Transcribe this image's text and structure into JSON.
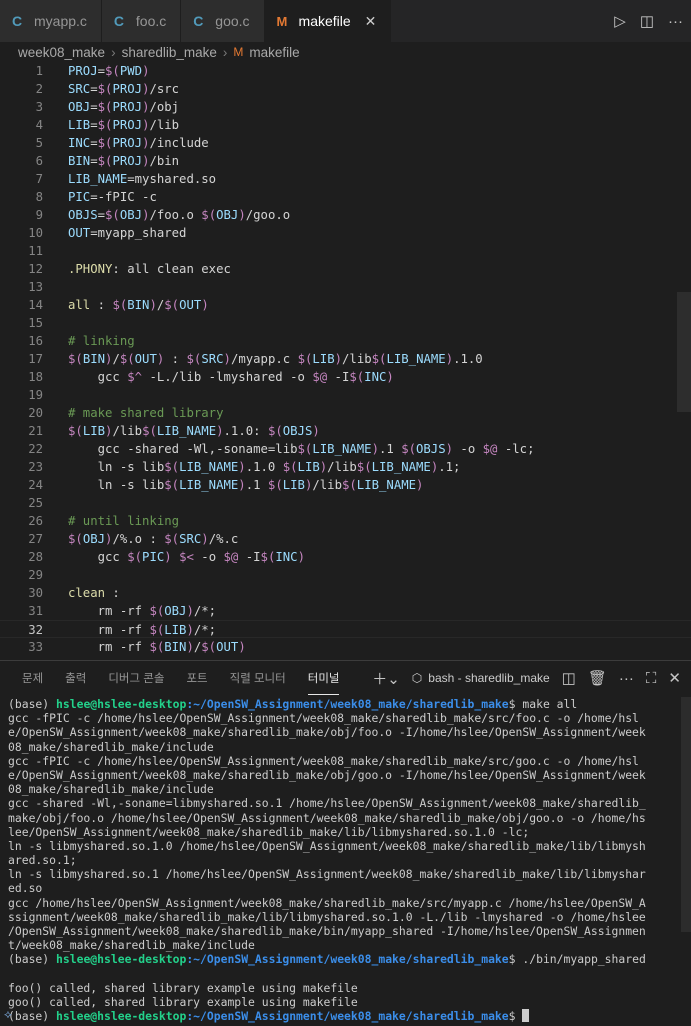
{
  "tabs": [
    {
      "label": "myapp.c",
      "icon": "c-file-icon",
      "active": false
    },
    {
      "label": "foo.c",
      "icon": "c-file-icon",
      "active": false
    },
    {
      "label": "goo.c",
      "icon": "c-file-icon",
      "active": false
    },
    {
      "label": "makefile",
      "icon": "makefile-icon",
      "active": true
    }
  ],
  "breadcrumb": [
    "week08_make",
    "sharedlib_make",
    "makefile"
  ],
  "editor": {
    "current_line": 32,
    "lines": [
      {
        "n": "1",
        "html": "<span class='v'>PROJ</span>=<span class='d'>$(</span><span class='v'>PWD</span><span class='d'>)</span>"
      },
      {
        "n": "2",
        "html": "<span class='v'>SRC</span>=<span class='d'>$(</span><span class='v'>PROJ</span><span class='d'>)</span>/src"
      },
      {
        "n": "3",
        "html": "<span class='v'>OBJ</span>=<span class='d'>$(</span><span class='v'>PROJ</span><span class='d'>)</span>/obj"
      },
      {
        "n": "4",
        "html": "<span class='v'>LIB</span>=<span class='d'>$(</span><span class='v'>PROJ</span><span class='d'>)</span>/lib"
      },
      {
        "n": "5",
        "html": "<span class='v'>INC</span>=<span class='d'>$(</span><span class='v'>PROJ</span><span class='d'>)</span>/include"
      },
      {
        "n": "6",
        "html": "<span class='v'>BIN</span>=<span class='d'>$(</span><span class='v'>PROJ</span><span class='d'>)</span>/bin"
      },
      {
        "n": "7",
        "html": "<span class='v'>LIB_NAME</span>=myshared.so"
      },
      {
        "n": "8",
        "html": "<span class='v'>PIC</span>=-fPIC -c"
      },
      {
        "n": "9",
        "html": "<span class='v'>OBJS</span>=<span class='d'>$(</span><span class='v'>OBJ</span><span class='d'>)</span>/foo.o <span class='d'>$(</span><span class='v'>OBJ</span><span class='d'>)</span>/goo.o"
      },
      {
        "n": "10",
        "html": "<span class='v'>OUT</span>=myapp_shared"
      },
      {
        "n": "11",
        "html": ""
      },
      {
        "n": "12",
        "html": "<span class='kw'>.PHONY</span>: all clean exec"
      },
      {
        "n": "13",
        "html": ""
      },
      {
        "n": "14",
        "html": "<span class='kw'>all</span> : <span class='d'>$(</span><span class='v'>BIN</span><span class='d'>)</span>/<span class='d'>$(</span><span class='v'>OUT</span><span class='d'>)</span>"
      },
      {
        "n": "15",
        "html": ""
      },
      {
        "n": "16",
        "html": "<span class='cm'># linking</span>"
      },
      {
        "n": "17",
        "html": "<span class='d'>$(</span><span class='v'>BIN</span><span class='d'>)</span>/<span class='d'>$(</span><span class='v'>OUT</span><span class='d'>)</span> : <span class='d'>$(</span><span class='v'>SRC</span><span class='d'>)</span>/myapp.c <span class='d'>$(</span><span class='v'>LIB</span><span class='d'>)</span>/lib<span class='d'>$(</span><span class='v'>LIB_NAME</span><span class='d'>)</span>.1.0"
      },
      {
        "n": "18",
        "html": "    gcc <span class='d'>$^</span> -L./lib -lmyshared -o <span class='d'>$@</span> -I<span class='d'>$(</span><span class='v'>INC</span><span class='d'>)</span>"
      },
      {
        "n": "19",
        "html": ""
      },
      {
        "n": "20",
        "html": "<span class='cm'># make shared library</span>"
      },
      {
        "n": "21",
        "html": "<span class='d'>$(</span><span class='v'>LIB</span><span class='d'>)</span>/lib<span class='d'>$(</span><span class='v'>LIB_NAME</span><span class='d'>)</span>.1.0: <span class='d'>$(</span><span class='v'>OBJS</span><span class='d'>)</span>"
      },
      {
        "n": "22",
        "html": "    gcc -shared -Wl,-soname=lib<span class='d'>$(</span><span class='v'>LIB_NAME</span><span class='d'>)</span>.1 <span class='d'>$(</span><span class='v'>OBJS</span><span class='d'>)</span> -o <span class='d'>$@</span> -lc;"
      },
      {
        "n": "23",
        "html": "    ln -s lib<span class='d'>$(</span><span class='v'>LIB_NAME</span><span class='d'>)</span>.1.0 <span class='d'>$(</span><span class='v'>LIB</span><span class='d'>)</span>/lib<span class='d'>$(</span><span class='v'>LIB_NAME</span><span class='d'>)</span>.1;"
      },
      {
        "n": "24",
        "html": "    ln -s lib<span class='d'>$(</span><span class='v'>LIB_NAME</span><span class='d'>)</span>.1 <span class='d'>$(</span><span class='v'>LIB</span><span class='d'>)</span>/lib<span class='d'>$(</span><span class='v'>LIB_NAME</span><span class='d'>)</span>"
      },
      {
        "n": "25",
        "html": ""
      },
      {
        "n": "26",
        "html": "<span class='cm'># until linking</span>"
      },
      {
        "n": "27",
        "html": "<span class='d'>$(</span><span class='v'>OBJ</span><span class='d'>)</span>/%.o : <span class='d'>$(</span><span class='v'>SRC</span><span class='d'>)</span>/%.c"
      },
      {
        "n": "28",
        "html": "    gcc <span class='d'>$(</span><span class='v'>PIC</span><span class='d'>)</span> <span class='d'>$&lt;</span> -o <span class='d'>$@</span> -I<span class='d'>$(</span><span class='v'>INC</span><span class='d'>)</span>"
      },
      {
        "n": "29",
        "html": ""
      },
      {
        "n": "30",
        "html": "<span class='kw'>clean</span> :"
      },
      {
        "n": "31",
        "html": "    rm -rf <span class='d'>$(</span><span class='v'>OBJ</span><span class='d'>)</span>/*;"
      },
      {
        "n": "32",
        "html": "    rm -rf <span class='d'>$(</span><span class='v'>LIB</span><span class='d'>)</span>/*;"
      },
      {
        "n": "33",
        "html": "    rm -rf <span class='d'>$(</span><span class='v'>BIN</span><span class='d'>)</span>/<span class='d'>$(</span><span class='v'>OUT</span><span class='d'>)</span>"
      }
    ]
  },
  "panel": {
    "tabs": [
      "문제",
      "출력",
      "디버그 콘솔",
      "포트",
      "직렬 모니터",
      "터미널"
    ],
    "active_tab": "터미널",
    "terminal_title": "bash - sharedlib_make"
  },
  "terminal": {
    "prompt_prefix": "(base) ",
    "user_host": "hslee@hslee-desktop",
    "path": ":~/OpenSW_Assignment/week08_make/sharedlib_make",
    "lines": [
      {
        "type": "prompt",
        "cmd": " make all"
      },
      {
        "type": "out",
        "text": "gcc -fPIC -c /home/hslee/OpenSW_Assignment/week08_make/sharedlib_make/src/foo.c -o /home/hsl"
      },
      {
        "type": "out",
        "text": "e/OpenSW_Assignment/week08_make/sharedlib_make/obj/foo.o -I/home/hslee/OpenSW_Assignment/week"
      },
      {
        "type": "out",
        "text": "08_make/sharedlib_make/include"
      },
      {
        "type": "out",
        "text": "gcc -fPIC -c /home/hslee/OpenSW_Assignment/week08_make/sharedlib_make/src/goo.c -o /home/hsl"
      },
      {
        "type": "out",
        "text": "e/OpenSW_Assignment/week08_make/sharedlib_make/obj/goo.o -I/home/hslee/OpenSW_Assignment/week"
      },
      {
        "type": "out",
        "text": "08_make/sharedlib_make/include"
      },
      {
        "type": "out",
        "text": "gcc -shared -Wl,-soname=libmyshared.so.1 /home/hslee/OpenSW_Assignment/week08_make/sharedlib_"
      },
      {
        "type": "out",
        "text": "make/obj/foo.o /home/hslee/OpenSW_Assignment/week08_make/sharedlib_make/obj/goo.o -o /home/hs"
      },
      {
        "type": "out",
        "text": "lee/OpenSW_Assignment/week08_make/sharedlib_make/lib/libmyshared.so.1.0 -lc;"
      },
      {
        "type": "out",
        "text": "ln -s libmyshared.so.1.0 /home/hslee/OpenSW_Assignment/week08_make/sharedlib_make/lib/libmysh"
      },
      {
        "type": "out",
        "text": "ared.so.1;"
      },
      {
        "type": "out",
        "text": "ln -s libmyshared.so.1 /home/hslee/OpenSW_Assignment/week08_make/sharedlib_make/lib/libmyshar"
      },
      {
        "type": "out",
        "text": "ed.so"
      },
      {
        "type": "out",
        "text": "gcc /home/hslee/OpenSW_Assignment/week08_make/sharedlib_make/src/myapp.c /home/hslee/OpenSW_A"
      },
      {
        "type": "out",
        "text": "ssignment/week08_make/sharedlib_make/lib/libmyshared.so.1.0 -L./lib -lmyshared -o /home/hslee"
      },
      {
        "type": "out",
        "text": "/OpenSW_Assignment/week08_make/sharedlib_make/bin/myapp_shared -I/home/hslee/OpenSW_Assignmen"
      },
      {
        "type": "out",
        "text": "t/week08_make/sharedlib_make/include"
      },
      {
        "type": "prompt",
        "cmd": " ./bin/myapp_shared"
      },
      {
        "type": "blank",
        "text": ""
      },
      {
        "type": "out",
        "text": "foo() called, shared library example using makefile"
      },
      {
        "type": "out",
        "text": "goo() called, shared library example using makefile"
      },
      {
        "type": "prompt",
        "cmd": "",
        "cursor": true
      }
    ]
  },
  "colors": {
    "accent_green": "#23d18b",
    "accent_blue": "#3b8eea",
    "makefile_icon": "#e37933",
    "c_icon": "#519aba"
  }
}
